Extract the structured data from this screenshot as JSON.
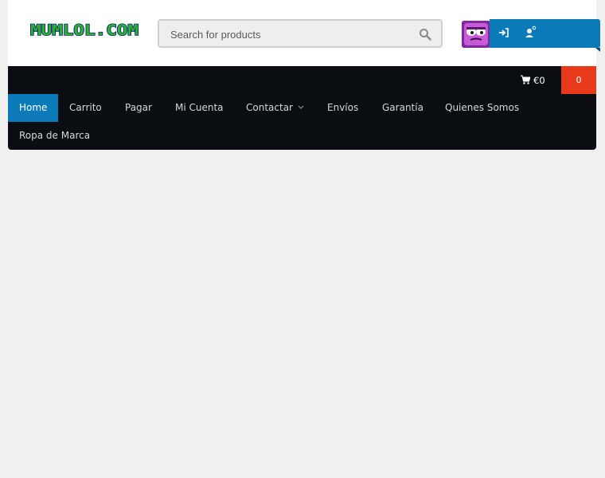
{
  "brand": {
    "logo_text": "MUMLOL.COM"
  },
  "search": {
    "placeholder": "Search for products"
  },
  "cart": {
    "total": "€0",
    "count": "0"
  },
  "menu": {
    "items": [
      {
        "label": "Home"
      },
      {
        "label": "Carrito"
      },
      {
        "label": "Pagar"
      },
      {
        "label": "Mi Cuenta"
      },
      {
        "label": "Contactar"
      },
      {
        "label": "Envíos"
      },
      {
        "label": "Garantía"
      },
      {
        "label": "Quienes Somos"
      },
      {
        "label": "Ropa de Marca"
      }
    ]
  },
  "colors": {
    "accent": "#0a7ab8",
    "nav_background": "#0a0d11",
    "cart_badge": "#e8391a",
    "page_background": "#f0f0f0"
  },
  "icons": {
    "search": "search-icon",
    "login": "login-icon",
    "register": "register-icon",
    "cart": "cart-icon",
    "dropdown": "chevron-down-icon"
  }
}
